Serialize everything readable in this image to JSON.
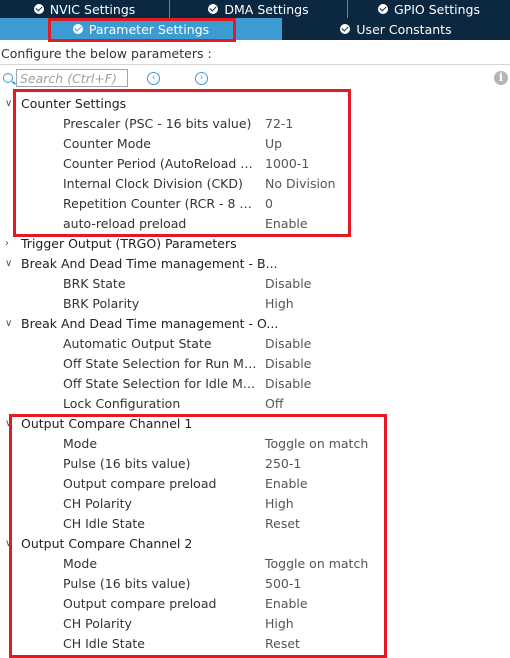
{
  "tabs_top": [
    {
      "label": "NVIC Settings"
    },
    {
      "label": "DMA Settings"
    },
    {
      "label": "GPIO Settings"
    }
  ],
  "tabs_bottom": [
    {
      "label": "Parameter Settings"
    },
    {
      "label": "User Constants"
    }
  ],
  "configure_text": "Configure the below parameters :",
  "search": {
    "placeholder": "Search (Ctrl+F)"
  },
  "icons": {
    "search": "search-icon",
    "prev": "chevron-left-icon",
    "next": "chevron-right-icon",
    "info": "info-icon",
    "check": "check-circle-icon"
  },
  "colors": {
    "header_dark": "#0c2740",
    "tab_active": "#3c9bd3",
    "highlight_box": "#e01b24"
  },
  "groups": [
    {
      "label": "Counter Settings",
      "expanded": true,
      "params": [
        {
          "name": "Prescaler (PSC - 16 bits value)",
          "value": "72-1"
        },
        {
          "name": "Counter Mode",
          "value": "Up"
        },
        {
          "name": "Counter Period (AutoReload Re...",
          "value": "1000-1"
        },
        {
          "name": "Internal Clock Division (CKD)",
          "value": "No Division"
        },
        {
          "name": "Repetition Counter (RCR - 8 bits...",
          "value": "0"
        },
        {
          "name": "auto-reload preload",
          "value": "Enable"
        }
      ]
    },
    {
      "label": "Trigger Output (TRGO) Parameters",
      "expanded": false,
      "params": []
    },
    {
      "label": "Break And Dead Time management - B...",
      "expanded": true,
      "params": [
        {
          "name": "BRK State",
          "value": "Disable"
        },
        {
          "name": "BRK Polarity",
          "value": "High"
        }
      ]
    },
    {
      "label": "Break And Dead Time management - O...",
      "expanded": true,
      "params": [
        {
          "name": "Automatic Output State",
          "value": "Disable"
        },
        {
          "name": "Off State Selection for Run Mod...",
          "value": "Disable"
        },
        {
          "name": "Off State Selection for Idle Mode...",
          "value": "Disable"
        },
        {
          "name": "Lock Configuration",
          "value": "Off"
        }
      ]
    },
    {
      "label": "Output Compare Channel 1",
      "expanded": true,
      "params": [
        {
          "name": "Mode",
          "value": "Toggle on match"
        },
        {
          "name": "Pulse (16 bits value)",
          "value": "250-1"
        },
        {
          "name": "Output compare preload",
          "value": "Enable"
        },
        {
          "name": "CH Polarity",
          "value": "High"
        },
        {
          "name": "CH Idle State",
          "value": "Reset"
        }
      ]
    },
    {
      "label": "Output Compare Channel 2",
      "expanded": true,
      "params": [
        {
          "name": "Mode",
          "value": "Toggle on match"
        },
        {
          "name": "Pulse (16 bits value)",
          "value": "500-1"
        },
        {
          "name": "Output compare preload",
          "value": "Enable"
        },
        {
          "name": "CH Polarity",
          "value": "High"
        },
        {
          "name": "CH Idle State",
          "value": "Reset"
        }
      ]
    }
  ]
}
